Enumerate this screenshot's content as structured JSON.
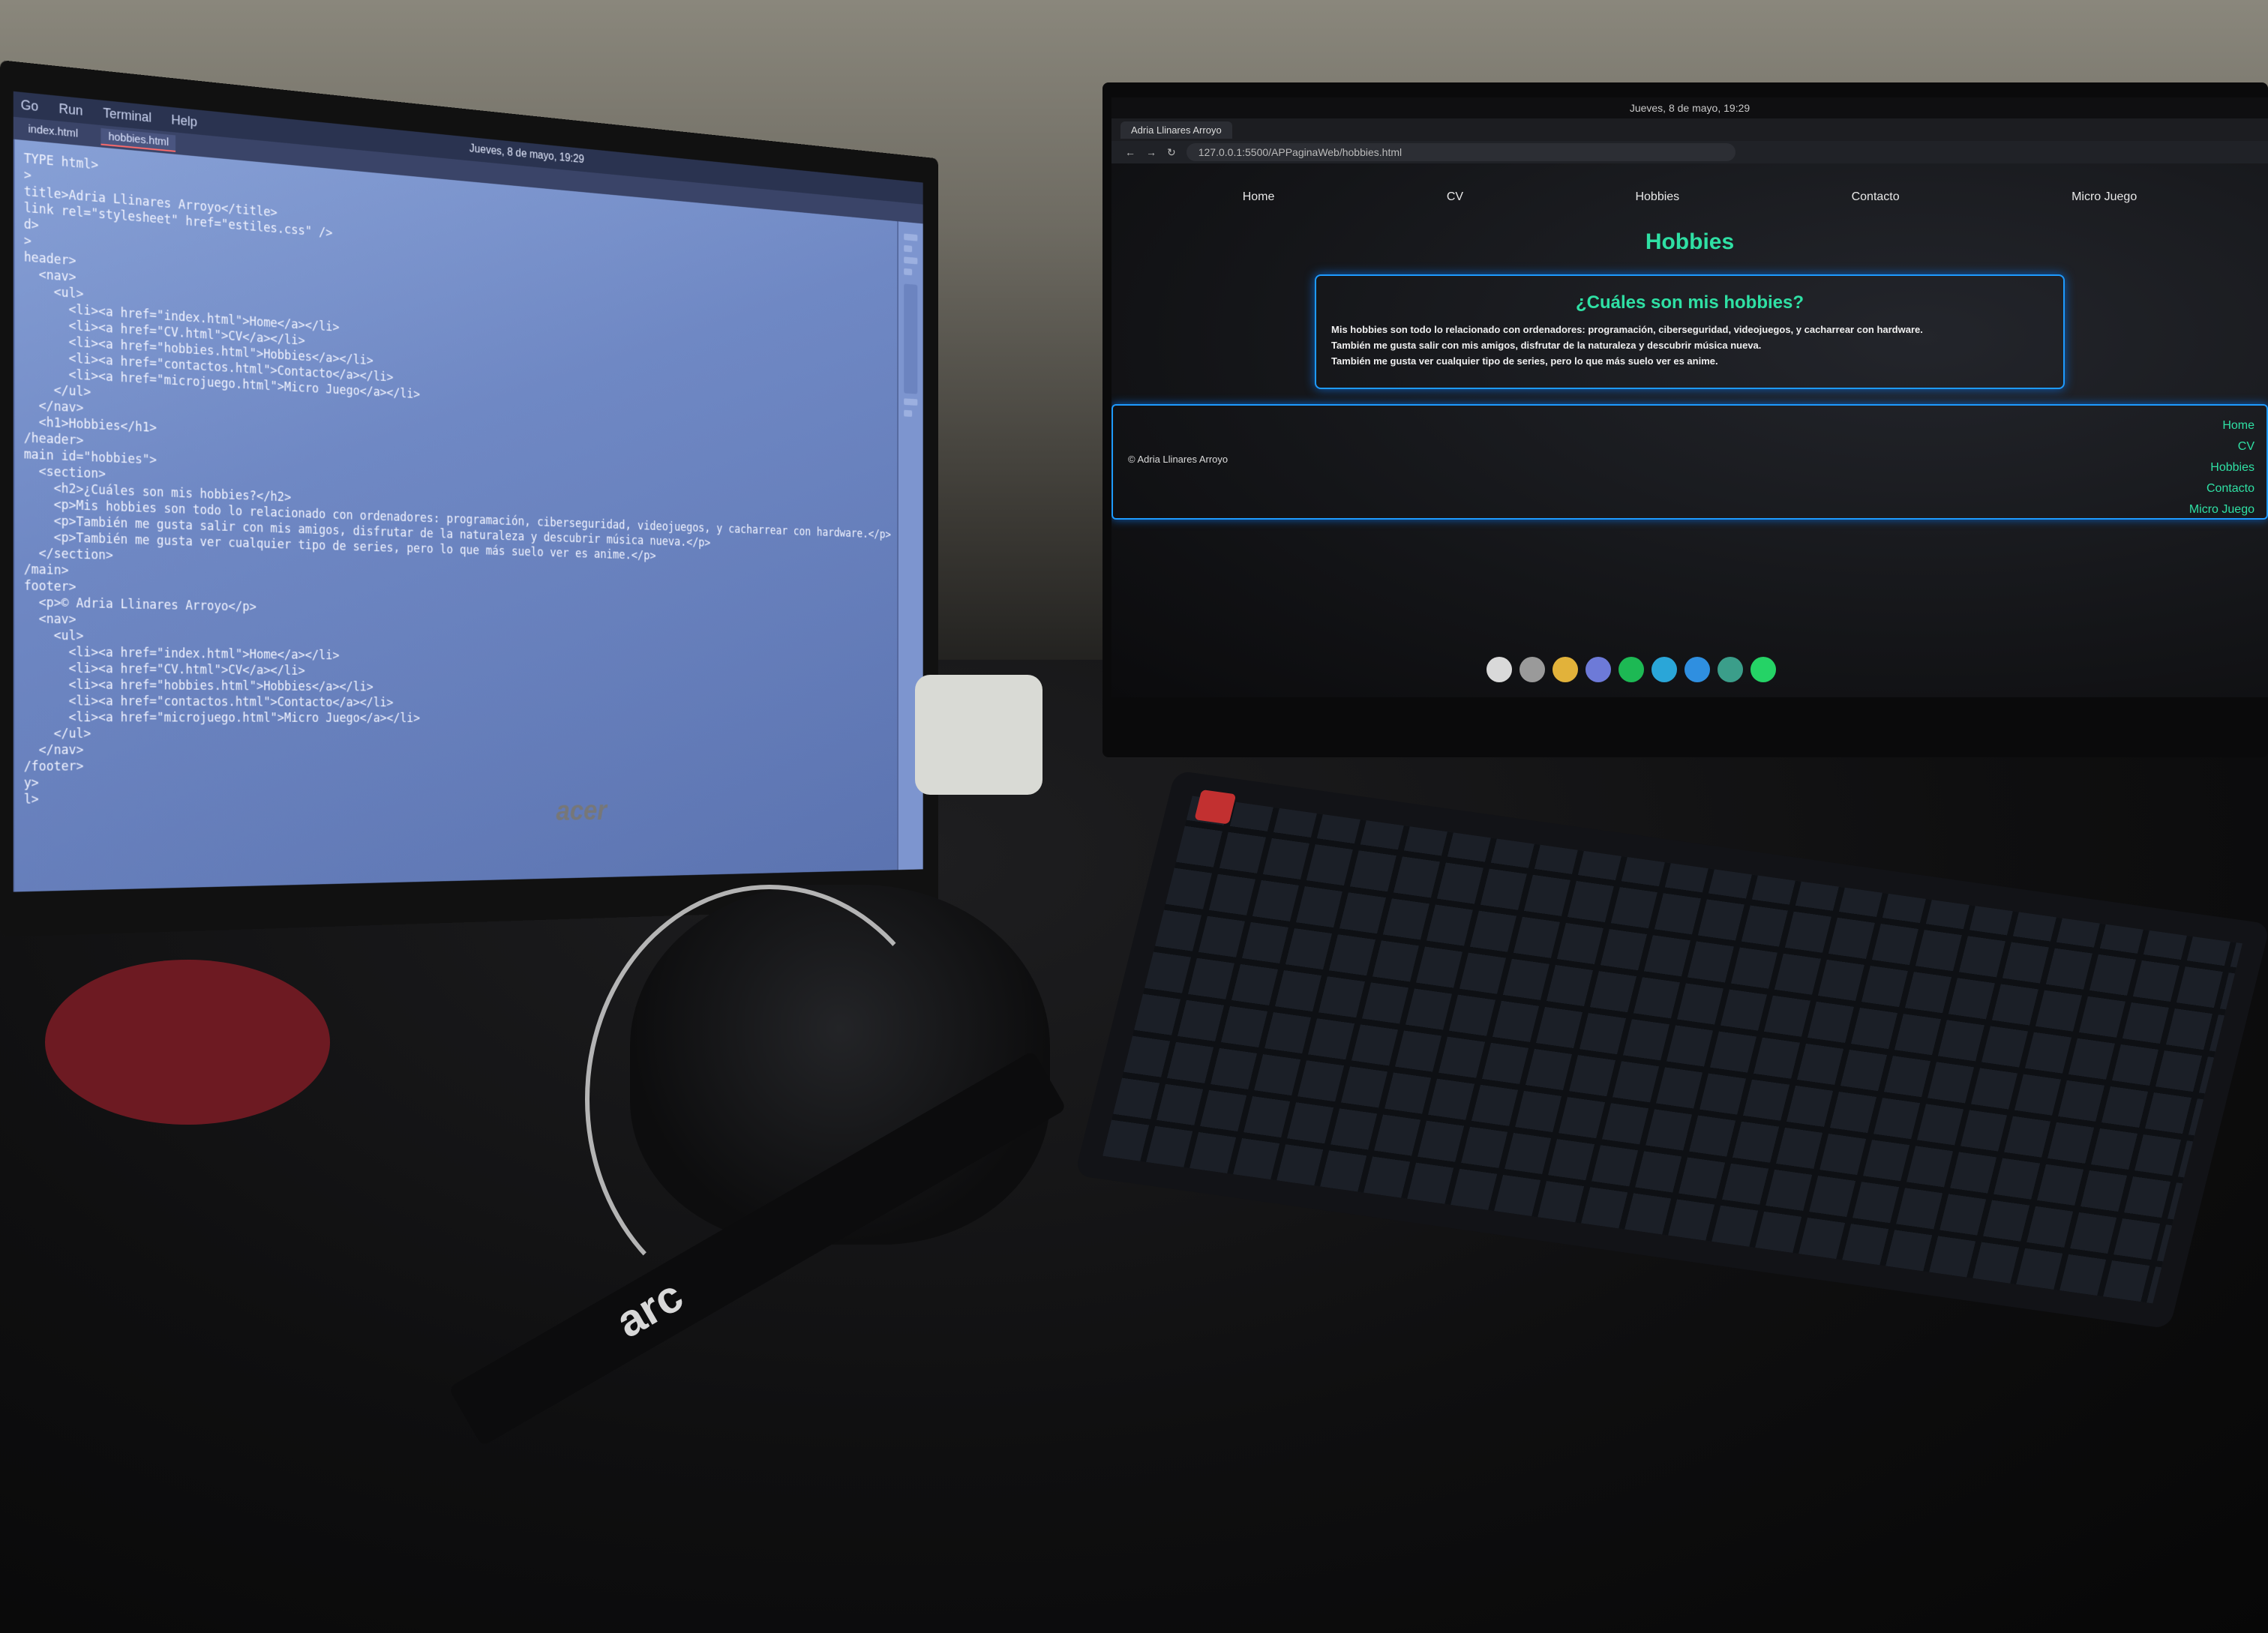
{
  "ide": {
    "menu": [
      "Go",
      "Run",
      "Terminal",
      "Help"
    ],
    "clock": "Jueves, 8 de mayo, 19:29",
    "tabs": [
      "index.html",
      "hobbies.html"
    ],
    "code_lines": [
      "TYPE html>",
      ">",
      "",
      "title>Adria Llinares Arroyo</title>",
      "link rel=\"stylesheet\" href=\"estiles.css\" />",
      "d>",
      "",
      ">",
      "",
      "header>",
      "  <nav>",
      "    <ul>",
      "      <li><a href=\"index.html\">Home</a></li>",
      "      <li><a href=\"CV.html\">CV</a></li>",
      "      <li><a href=\"hobbies.html\">Hobbies</a></li>",
      "      <li><a href=\"contactos.html\">Contacto</a></li>",
      "      <li><a href=\"microjuego.html\">Micro Juego</a></li>",
      "    </ul>",
      "  </nav>",
      "  <h1>Hobbies</h1>",
      "/header>",
      "",
      "main id=\"hobbies\">",
      "  <section>",
      "    <h2>¿Cuáles son mis hobbies?</h2>",
      "    <p>Mis hobbies son todo lo relacionado con ordenadores: programación, ciberseguridad, videojuegos, y cacharrear con hardware.</p>",
      "    <p>También me gusta salir con mis amigos, disfrutar de la naturaleza y descubrir música nueva.</p>",
      "    <p>También me gusta ver cualquier tipo de series, pero lo que más suelo ver es anime.</p>",
      "  </section>",
      "/main>",
      "",
      "footer>",
      "  <p>© Adria Llinares Arroyo</p>",
      "  <nav>",
      "    <ul>",
      "      <li><a href=\"index.html\">Home</a></li>",
      "      <li><a href=\"CV.html\">CV</a></li>",
      "      <li><a href=\"hobbies.html\">Hobbies</a></li>",
      "      <li><a href=\"contactos.html\">Contacto</a></li>",
      "      <li><a href=\"microjuego.html\">Micro Juego</a></li>",
      "    </ul>",
      "  </nav>",
      "/footer>",
      "",
      "y>",
      "l>"
    ],
    "brand": "acer"
  },
  "browser": {
    "topbar_clock": "Jueves, 8 de mayo, 19:29",
    "tab_title": "Adria Llinares Arroyo",
    "url": "127.0.0.1:5500/APPaginaWeb/hobbies.html",
    "nav": [
      "Home",
      "CV",
      "Hobbies",
      "Contacto",
      "Micro Juego"
    ],
    "title": "Hobbies",
    "section_heading": "¿Cuáles son mis hobbies?",
    "paragraphs": [
      "Mis hobbies son todo lo relacionado con ordenadores: programación, ciberseguridad, videojuegos, y cacharrear con hardware.",
      "También me gusta salir con mis amigos, disfrutar de la naturaleza y descubrir música nueva.",
      "También me gusta ver cualquier tipo de series, pero lo que más suelo ver es anime."
    ],
    "footer_copy": "© Adria Llinares Arroyo",
    "footer_nav": [
      "Home",
      "CV",
      "Hobbies",
      "Contacto",
      "Micro Juego"
    ],
    "accent_color": "#2fe0a4",
    "border_color": "#1e9bff"
  },
  "dock_icons": [
    {
      "name": "files-icon",
      "color": "#d9d9d9"
    },
    {
      "name": "terminal-icon",
      "color": "#9a9a9a"
    },
    {
      "name": "chrome-icon",
      "color": "#e2b23a"
    },
    {
      "name": "discord-icon",
      "color": "#6d7ad8"
    },
    {
      "name": "spotify-icon",
      "color": "#1db954"
    },
    {
      "name": "app-icon",
      "color": "#2aa6d8"
    },
    {
      "name": "vscode-icon",
      "color": "#2f8fe0"
    },
    {
      "name": "app2-icon",
      "color": "#3b9e8a"
    },
    {
      "name": "whatsapp-icon",
      "color": "#25d366"
    }
  ],
  "strap_text": "arc"
}
